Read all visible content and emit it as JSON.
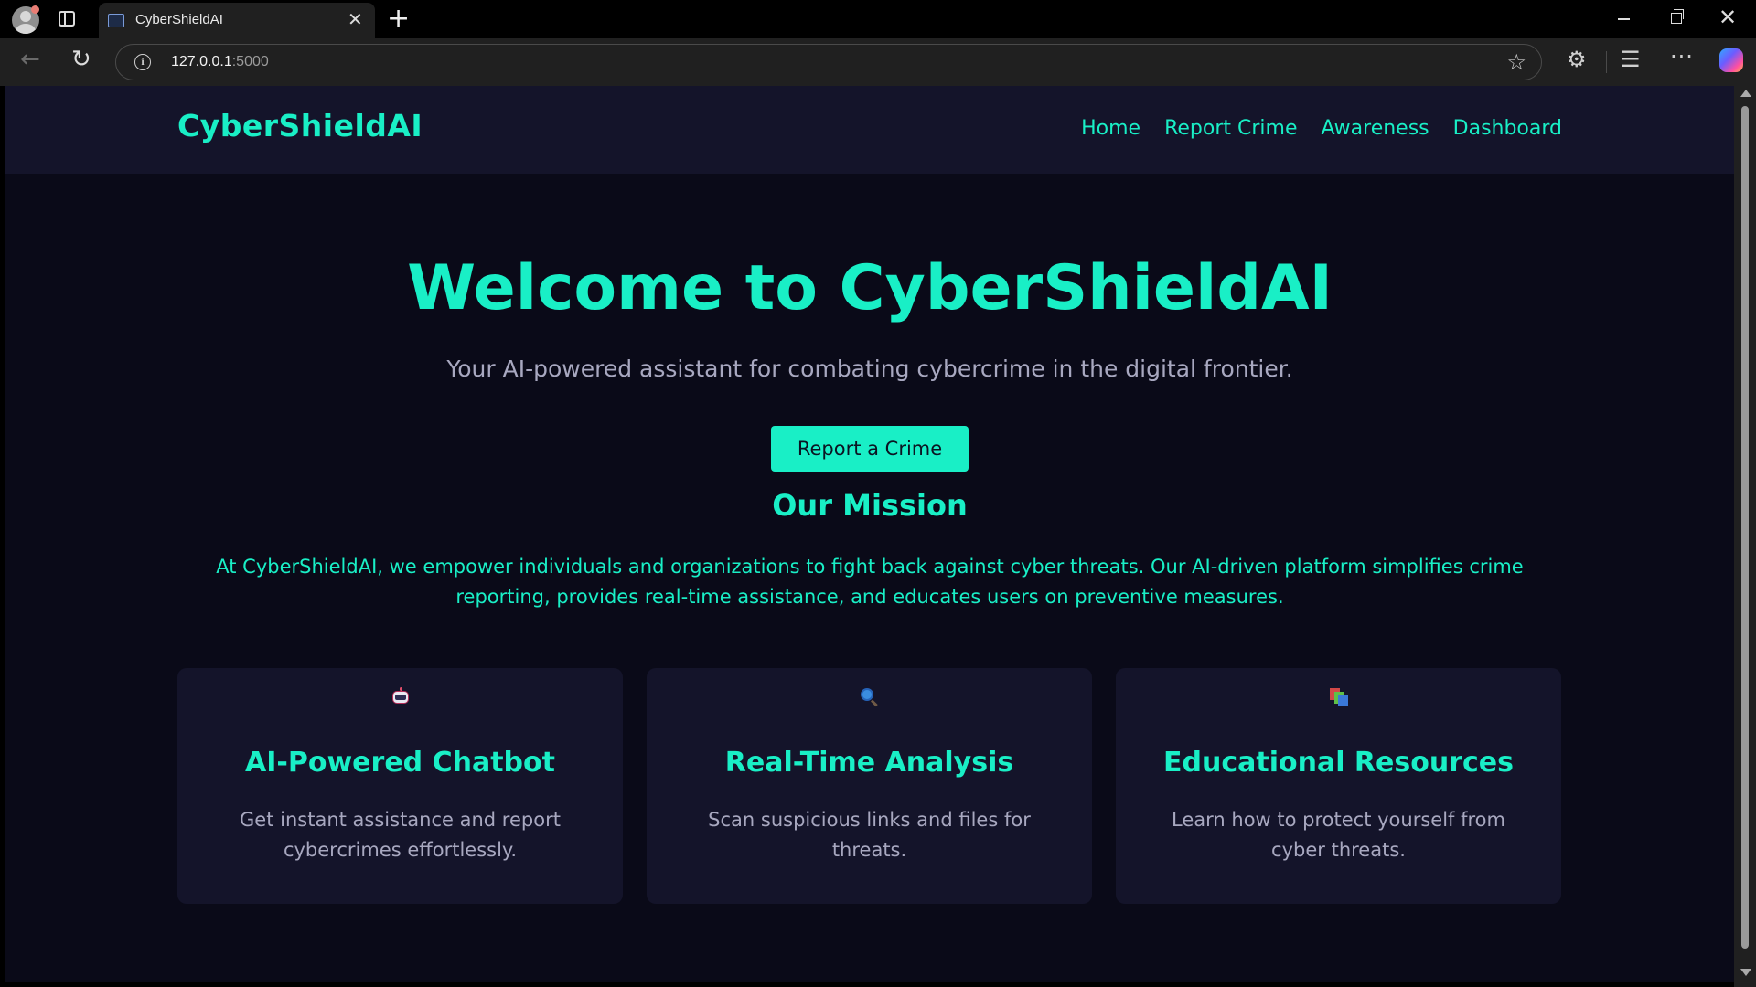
{
  "browser": {
    "tab_title": "CyberShieldAI",
    "url_host": "127.0.0.1",
    "url_port": ":5000"
  },
  "site": {
    "brand": "CyberShieldAI",
    "nav": [
      "Home",
      "Report Crime",
      "Awareness",
      "Dashboard"
    ]
  },
  "hero": {
    "title": "Welcome to CyberShieldAI",
    "subtitle": "Your AI-powered assistant for combating cybercrime in the digital frontier.",
    "cta_label": "Report a Crime"
  },
  "mission": {
    "title": "Our Mission",
    "text": "At CyberShieldAI, we empower individuals and organizations to fight back against cyber threats. Our AI-driven platform simplifies crime reporting, provides real-time assistance, and educates users on preventive measures."
  },
  "features": [
    {
      "icon": "robot-icon",
      "title": "AI-Powered Chatbot",
      "description": "Get instant assistance and report cybercrimes effortlessly."
    },
    {
      "icon": "magnifier-icon",
      "title": "Real-Time Analysis",
      "description": "Scan suspicious links and files for threats."
    },
    {
      "icon": "books-icon",
      "title": "Educational Resources",
      "description": "Learn how to protect yourself from cyber threats."
    }
  ],
  "colors": {
    "accent": "#19efc6",
    "background": "#0a0a18",
    "header": "#14142a",
    "muted_text": "#a8a8c0"
  }
}
